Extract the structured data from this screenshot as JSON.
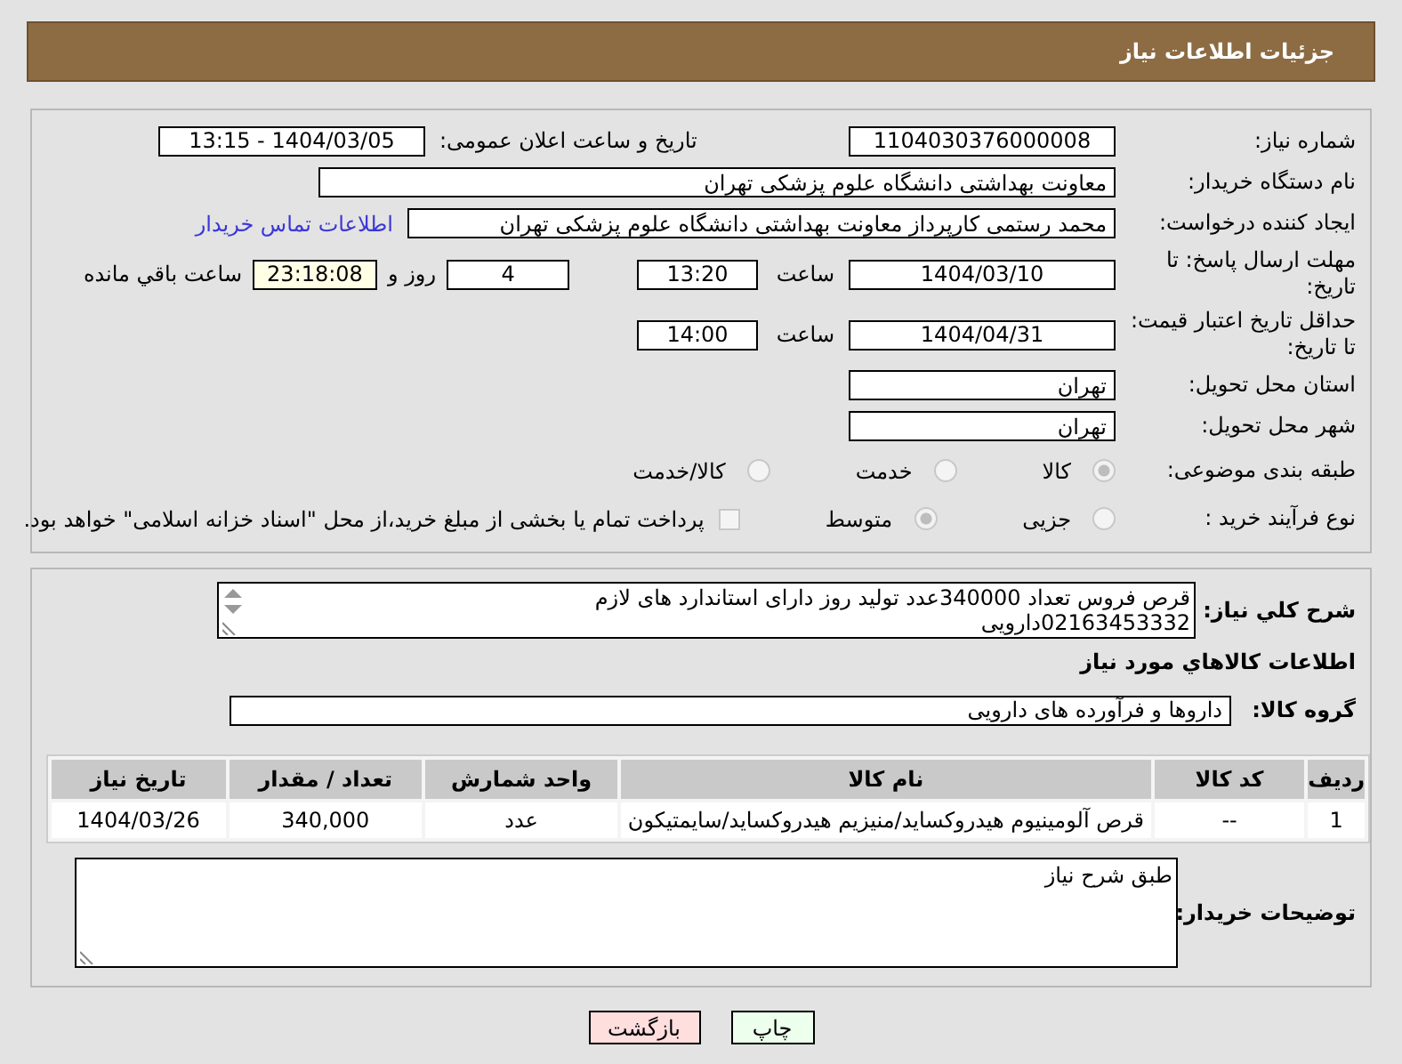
{
  "header": {
    "title": "جزئیات اطلاعات نیاز"
  },
  "need_number": {
    "label": "شماره نیاز:",
    "value": "1104030376000008"
  },
  "announce": {
    "label": "تاریخ و ساعت اعلان عمومی:",
    "value": "1404/03/05 - 13:15"
  },
  "buyer_org": {
    "label": "نام دستگاه خریدار:",
    "value": "معاونت بهداشتی دانشگاه علوم پزشکی تهران"
  },
  "creator": {
    "label": "ایجاد کننده درخواست:",
    "value": "محمد رستمی کارپرداز معاونت بهداشتی دانشگاه علوم پزشکی تهران",
    "link": "اطلاعات تماس خریدار"
  },
  "deadline": {
    "label": "مهلت ارسال پاسخ: تا تاریخ:",
    "date": "1404/03/10",
    "time_label": "ساعت",
    "time": "13:20",
    "days": "4",
    "days_label": "روز و",
    "remaining": "23:18:08",
    "remaining_label": "ساعت باقي مانده"
  },
  "validity": {
    "label": "حداقل تاریخ اعتبار قیمت: تا تاریخ:",
    "date": "1404/04/31",
    "time_label": "ساعت",
    "time": "14:00"
  },
  "province": {
    "label": "استان محل تحویل:",
    "value": "تهران"
  },
  "city": {
    "label": "شهر محل تحویل:",
    "value": "تهران"
  },
  "category": {
    "label": "طبقه بندی موضوعی:",
    "options": [
      {
        "label": "کالا",
        "selected": true
      },
      {
        "label": "خدمت",
        "selected": false
      },
      {
        "label": "کالا/خدمت",
        "selected": false
      }
    ]
  },
  "process": {
    "label": "نوع فرآیند خرید :",
    "options": [
      {
        "label": "جزیی",
        "selected": false
      },
      {
        "label": "متوسط",
        "selected": true
      }
    ],
    "treasury": {
      "checked": false,
      "label": "پرداخت تمام یا بخشی از مبلغ خرید،از محل \"اسناد خزانه اسلامی\" خواهد بود."
    }
  },
  "description": {
    "label": "شرح کلي نیاز:",
    "value": "قرص فروس تعداد 340000عدد تولید روز دارای استاندارد های لازم 02163453332دارویی"
  },
  "items_heading": "اطلاعات کالاهاي مورد نیاز",
  "group": {
    "label": "گروه کالا:",
    "value": "داروها و فرآورده های دارویی"
  },
  "table": {
    "columns": [
      "ردیف",
      "کد کالا",
      "نام کالا",
      "واحد شمارش",
      "تعداد / مقدار",
      "تاریخ نیاز"
    ],
    "rows": [
      [
        "1",
        "--",
        "قرص آلومینیوم هیدروکساید/منیزیم هیدروکساید/سایمتیکون",
        "عدد",
        "340,000",
        "1404/03/26"
      ]
    ]
  },
  "buyer_notes": {
    "label": "توضیحات خریدار:",
    "value": "طبق شرح نیاز"
  },
  "buttons": [
    {
      "label": "چاپ",
      "kind": "print"
    },
    {
      "label": "بازگشت",
      "kind": "back"
    }
  ]
}
